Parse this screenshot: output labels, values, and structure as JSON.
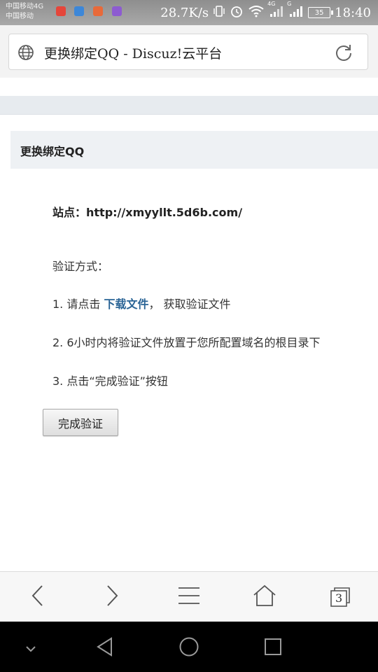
{
  "status_bar": {
    "carrier_1": "中国移动4G",
    "carrier_2": "中国移动",
    "net_speed": "28.7K/s",
    "battery": "35",
    "time": "18:40",
    "signal_1": "4G",
    "signal_2": "G",
    "notification_colors": [
      "#e5463b",
      "#3d87d8",
      "#e86a3a",
      "#8d5bd1"
    ]
  },
  "browser": {
    "page_title": "更换绑定QQ - Discuz!云平台",
    "toolbar": {
      "tabs_count": "3"
    }
  },
  "page": {
    "header_title": "更换绑定QQ",
    "site_label": "站点：",
    "site_url": "http://xmyyllt.5d6b.com/",
    "verify_method": "验证方式：",
    "step1_prefix": "1. 请点击 ",
    "step1_link": "下载文件",
    "step1_suffix": "， 获取验证文件",
    "step2": "2. 6小时内将验证文件放置于您所配置域名的根目录下",
    "step3": "3. 点击“完成验证”按钮",
    "complete_button": "完成验证"
  }
}
